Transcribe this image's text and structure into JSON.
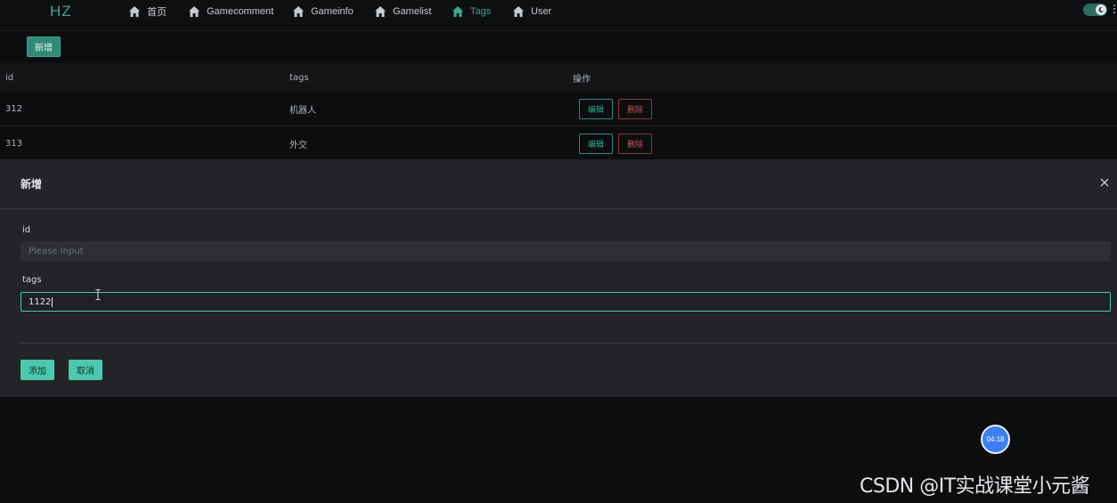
{
  "brand": "HZ",
  "nav": [
    {
      "label": "首页",
      "icon": "home-icon",
      "active": false
    },
    {
      "label": "Gamecomment",
      "icon": "home-icon",
      "active": false
    },
    {
      "label": "Gameinfo",
      "icon": "home-icon",
      "active": false
    },
    {
      "label": "Gamelist",
      "icon": "home-icon",
      "active": false
    },
    {
      "label": "Tags",
      "icon": "home-icon",
      "active": true
    },
    {
      "label": "User",
      "icon": "home-icon",
      "active": false
    }
  ],
  "toolbar": {
    "add_label": "新增"
  },
  "table": {
    "headers": [
      "id",
      "tags",
      "操作"
    ],
    "rows": [
      {
        "id": "312",
        "tags": "机器人",
        "edit": "编辑",
        "delete": "删除"
      },
      {
        "id": "313",
        "tags": "外交",
        "edit": "编辑",
        "delete": "删除"
      }
    ]
  },
  "modal": {
    "title": "新增",
    "fields": [
      {
        "label": "id",
        "value": "",
        "placeholder": "Please Input"
      },
      {
        "label": "tags",
        "value": "1122",
        "placeholder": ""
      }
    ],
    "submit_label": "添加",
    "cancel_label": "取消"
  },
  "timer": "04:18",
  "watermark": "CSDN @IT实战课堂小元酱",
  "colors": {
    "accent": "#3aa88f",
    "danger": "#c15a5a",
    "timer": "#3d7ff0"
  }
}
